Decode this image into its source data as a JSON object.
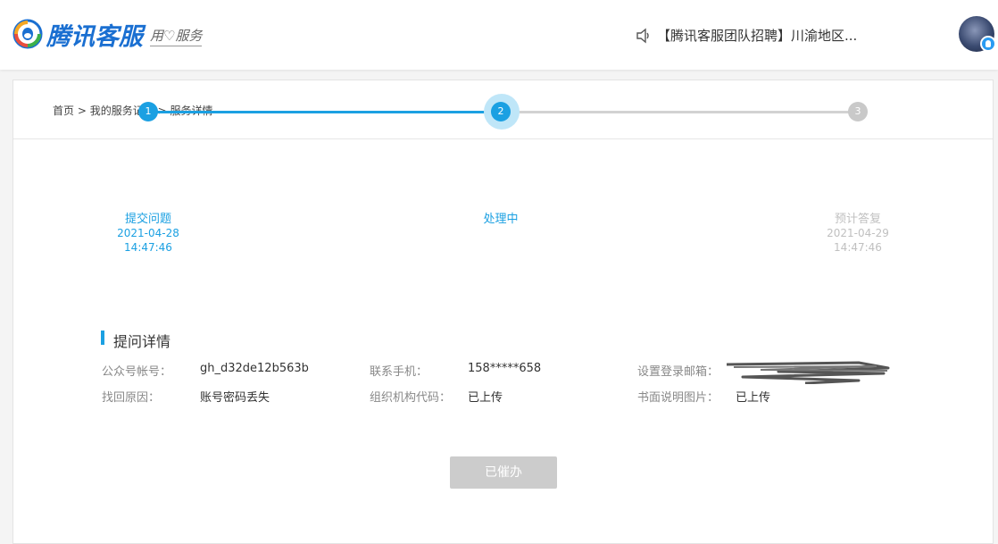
{
  "header": {
    "logo_text": "腾讯客服",
    "logo_slogan": "用♡服务",
    "notice": "【腾讯客服团队招聘】川渝地区..."
  },
  "breadcrumb": {
    "home": "首页",
    "sep": ">",
    "records": "我的服务记录",
    "current": "服务详情"
  },
  "steps": [
    {
      "num": "1",
      "title": "提交问题",
      "date": "2021-04-28",
      "time": "14:47:46",
      "state": "done"
    },
    {
      "num": "2",
      "title": "处理中",
      "date": "",
      "time": "",
      "state": "current"
    },
    {
      "num": "3",
      "title": "预计答复",
      "date": "2021-04-29",
      "time": "14:47:46",
      "state": "todo"
    }
  ],
  "details": {
    "title": "提问详情",
    "fields": [
      {
        "label": "公众号帐号：",
        "value": "gh_d32de12b563b"
      },
      {
        "label": "联系手机：",
        "value": "158*****658"
      },
      {
        "label": "设置登录邮箱：",
        "value": ""
      },
      {
        "label": "找回原因：",
        "value": "账号密码丢失"
      },
      {
        "label": "组织机构代码：",
        "value": "已上传"
      },
      {
        "label": "书面说明图片：",
        "value": "已上传"
      }
    ]
  },
  "button": {
    "label": "已催办"
  },
  "colors": {
    "accent": "#1ba0e2",
    "inactive": "#c9c9c9",
    "brand": "#1a6fd1"
  }
}
